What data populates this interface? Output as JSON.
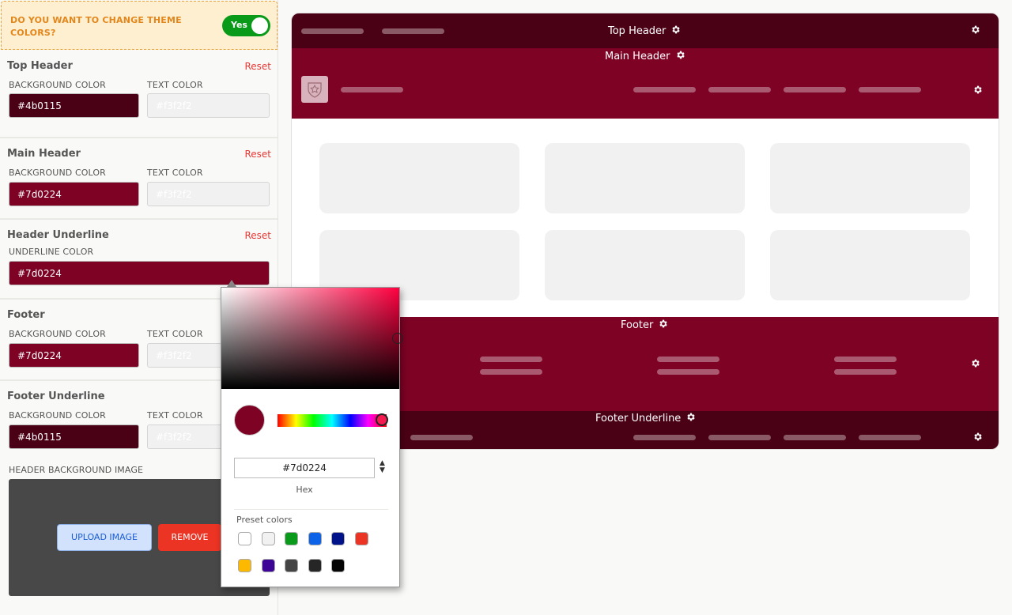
{
  "theme_prompt": {
    "question": "DO YOU WANT TO CHANGE THEME COLORS?",
    "toggle_label": "Yes",
    "toggle_on": true
  },
  "sections": {
    "top_header": {
      "title": "Top Header",
      "reset": "Reset",
      "bg_label": "BACKGROUND COLOR",
      "bg_value": "#4b0115",
      "text_label": "TEXT COLOR",
      "text_value": "#f3f2f2"
    },
    "main_header": {
      "title": "Main Header",
      "reset": "Reset",
      "bg_label": "BACKGROUND COLOR",
      "bg_value": "#7d0224",
      "text_label": "TEXT COLOR",
      "text_value": "#f3f2f2"
    },
    "header_underline": {
      "title": "Header Underline",
      "reset": "Reset",
      "underline_label": "UNDERLINE COLOR",
      "underline_value": "#7d0224"
    },
    "footer": {
      "title": "Footer",
      "bg_label": "BACKGROUND COLOR",
      "bg_value": "#7d0224",
      "text_label": "TEXT COLOR",
      "text_value": "#f3f2f2"
    },
    "footer_underline": {
      "title": "Footer Underline",
      "bg_label": "BACKGROUND COLOR",
      "bg_value": "#4b0115",
      "text_label": "TEXT COLOR",
      "text_value": "#f3f2f2"
    },
    "header_image": {
      "label": "HEADER BACKGROUND IMAGE",
      "upload": "UPLOAD IMAGE",
      "remove": "REMOVE"
    }
  },
  "preview": {
    "top_header": "Top Header",
    "main_header": "Main Header",
    "footer": "Footer",
    "footer_underline": "Footer Underline",
    "colors": {
      "top_header": "#4b0115",
      "main_header": "#7d0224",
      "footer": "#7d0224",
      "footer_underline": "#4b0115"
    }
  },
  "picker": {
    "hex_value": "#7d0224",
    "hex_label": "Hex",
    "current_color": "#7d0224",
    "preset_label": "Preset colors",
    "presets": [
      "#ffffff",
      "#f1f1f1",
      "#0a9a1a",
      "#0d63e8",
      "#00128a",
      "#ec3424",
      "#fcb900",
      "#3c0596",
      "#444444",
      "#262626",
      "#050505"
    ]
  }
}
